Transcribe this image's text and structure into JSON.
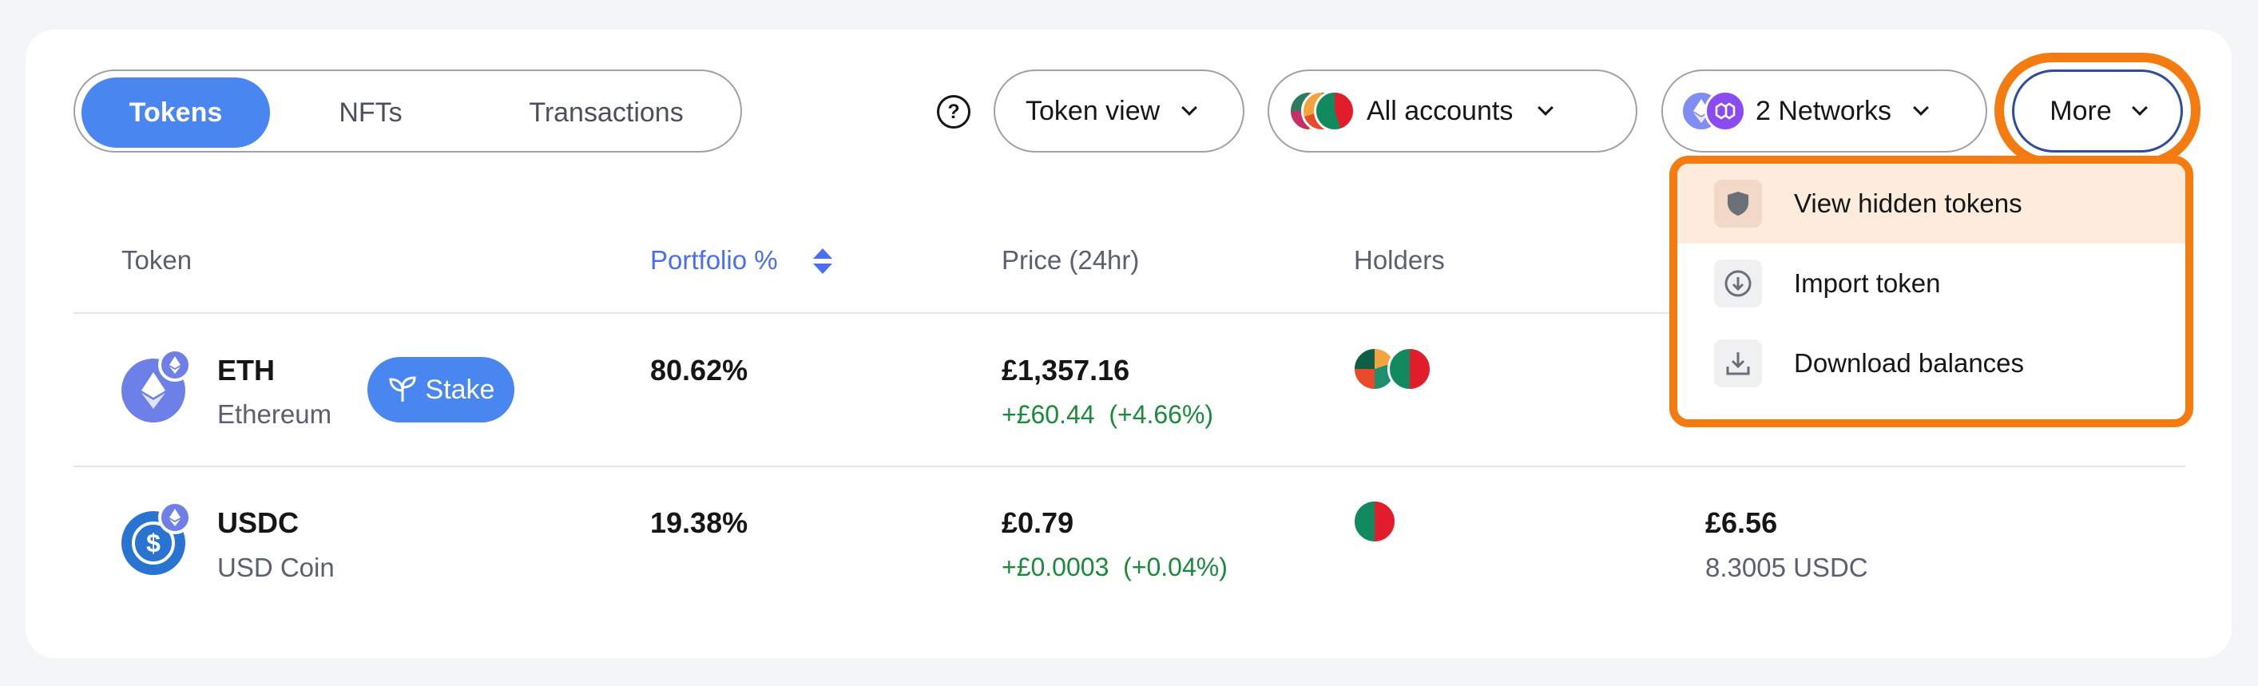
{
  "tabs": [
    {
      "label": "Tokens",
      "active": true
    },
    {
      "label": "NFTs",
      "active": false
    },
    {
      "label": "Transactions",
      "active": false
    }
  ],
  "toolbar": {
    "help_icon": "question-circle-icon",
    "token_view": "Token view",
    "accounts": "All accounts",
    "networks": "2 Networks",
    "more": "More"
  },
  "table": {
    "headers": {
      "token": "Token",
      "portfolio": "Portfolio %",
      "price": "Price (24hr)",
      "holders": "Holders"
    },
    "rows": [
      {
        "symbol": "ETH",
        "name": "Ethereum",
        "stake_label": "Stake",
        "portfolio": "80.62%",
        "price": "£1,357.16",
        "change_abs": "+£60.44",
        "change_pct": "(+4.66%)",
        "balance": "",
        "balance_sub": ""
      },
      {
        "symbol": "USDC",
        "name": "USD Coin",
        "portfolio": "19.38%",
        "price": "£0.79",
        "change_abs": "+£0.0003",
        "change_pct": "(+0.04%)",
        "balance": "£6.56",
        "balance_sub": "8.3005 USDC"
      }
    ]
  },
  "menu": {
    "items": [
      {
        "label": "View hidden tokens",
        "icon": "shield-icon"
      },
      {
        "label": "Import token",
        "icon": "arrow-down-circle-icon"
      },
      {
        "label": "Download balances",
        "icon": "download-icon"
      }
    ]
  },
  "colors": {
    "accent": "#4a86f0",
    "highlight": "#f37b0f",
    "positive": "#1a8a3b"
  }
}
